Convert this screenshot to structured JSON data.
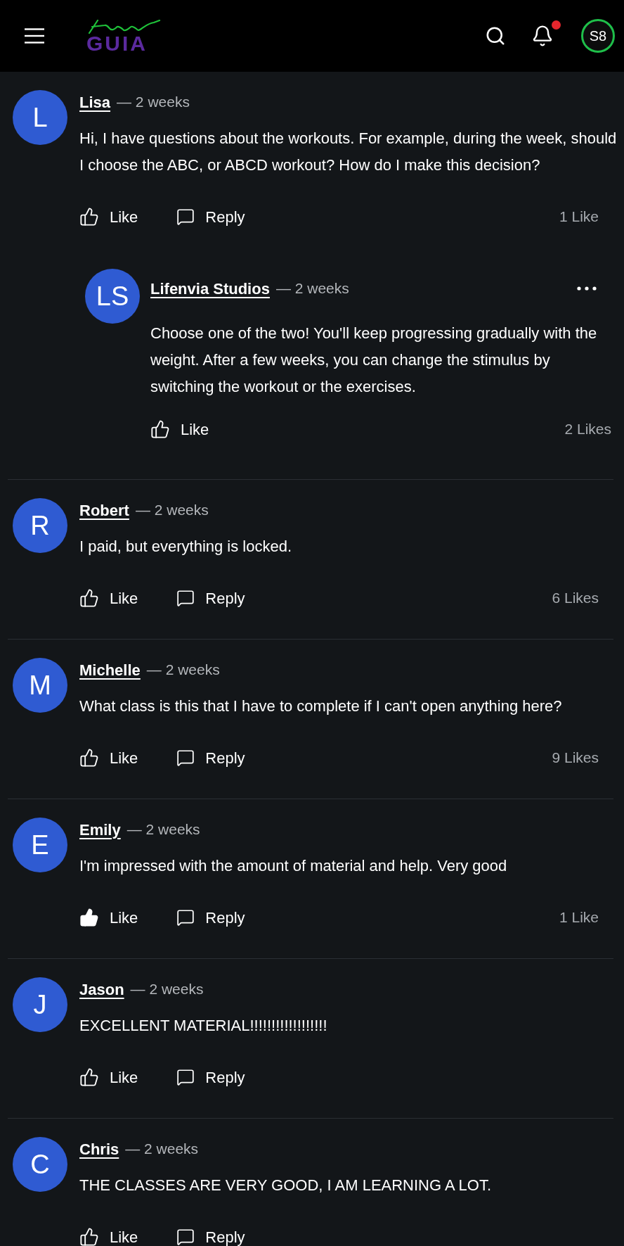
{
  "header": {
    "logo": "GUIA",
    "has_notifications": true,
    "user_initials": "S8"
  },
  "comments": [
    {
      "initials": "L",
      "author": "Lisa",
      "time": "— 2 weeks",
      "text": "Hi, I have questions about the workouts. For example, during the week, should I choose the ABC, or ABCD workout? How do I make this decision?",
      "liked": false,
      "like_label": "Like",
      "reply_label": "Reply",
      "likes": "1 Like",
      "replies": [
        {
          "initials": "LS",
          "author": "Lifenvia Studios",
          "time": "— 2 weeks",
          "more_menu": true,
          "text": "Choose one of the two! You'll keep progressing gradually with the weight. After a few weeks, you can change the stimulus by switching the workout or the exercises.",
          "liked": false,
          "like_label": "Like",
          "likes": "2 Likes"
        }
      ]
    },
    {
      "initials": "R",
      "author": "Robert",
      "time": "— 2 weeks",
      "text": "I paid, but everything is locked.",
      "liked": false,
      "like_label": "Like",
      "reply_label": "Reply",
      "likes": "6 Likes"
    },
    {
      "initials": "M",
      "author": "Michelle",
      "time": "— 2 weeks",
      "text": "What class is this that I have to complete if I can't open anything here?",
      "liked": false,
      "like_label": "Like",
      "reply_label": "Reply",
      "likes": "9 Likes"
    },
    {
      "initials": "E",
      "author": "Emily",
      "time": "— 2 weeks",
      "text": "I'm impressed with the amount of material and help. Very good",
      "liked": true,
      "like_label": "Like",
      "reply_label": "Reply",
      "likes": "1 Like"
    },
    {
      "initials": "J",
      "author": "Jason",
      "time": "— 2 weeks",
      "text": "EXCELLENT MATERIAL!!!!!!!!!!!!!!!!!!",
      "liked": false,
      "like_label": "Like",
      "reply_label": "Reply"
    },
    {
      "initials": "C",
      "author": "Chris",
      "time": "— 2 weeks",
      "text": "THE CLASSES ARE VERY GOOD, I AM LEARNING A LOT.",
      "liked": false,
      "like_label": "Like",
      "reply_label": "Reply"
    }
  ]
}
